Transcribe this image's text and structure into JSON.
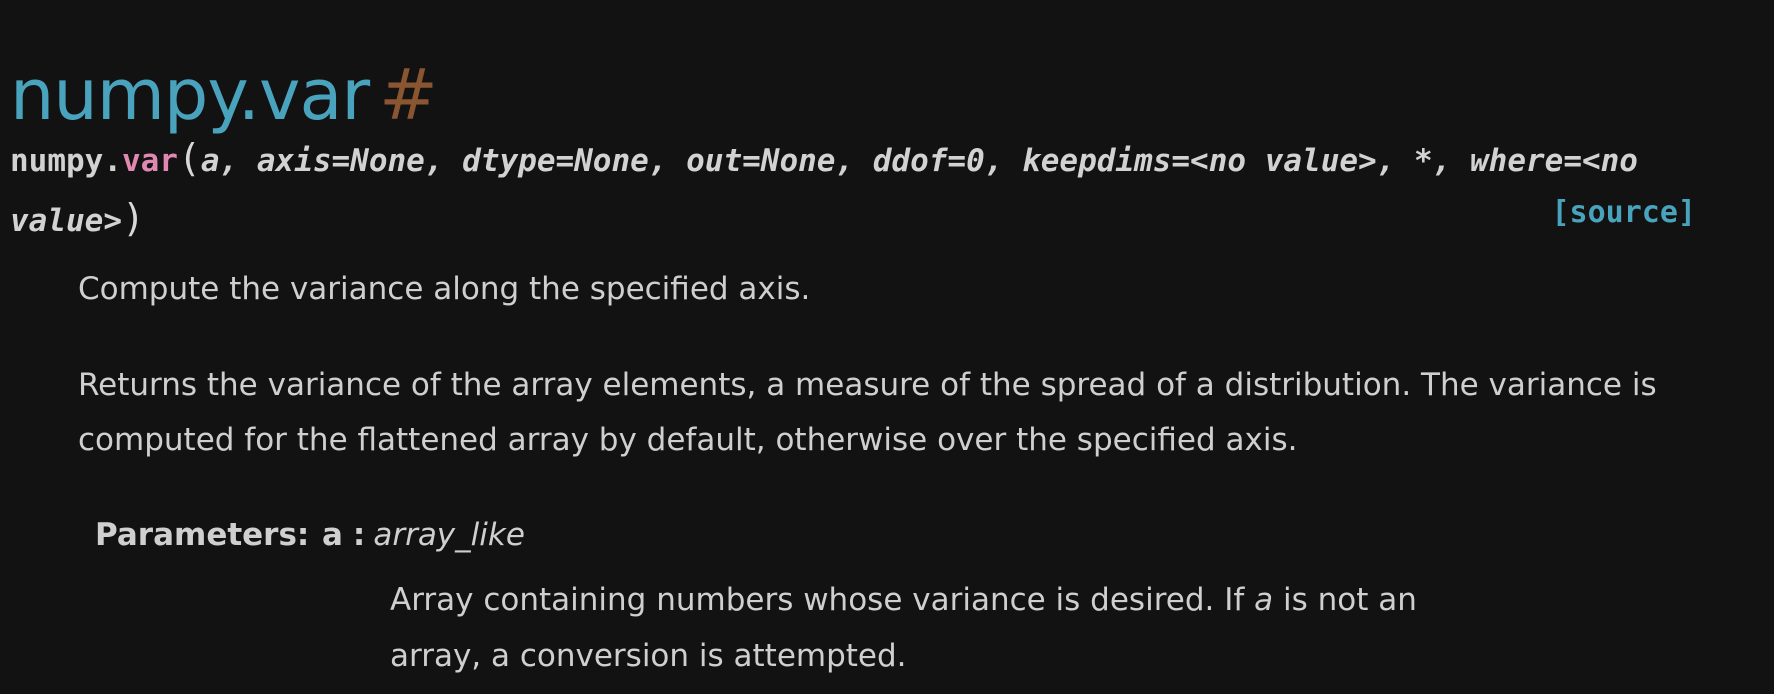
{
  "header": {
    "title": "numpy.var",
    "anchor": "#"
  },
  "signature": {
    "module": "numpy.",
    "function": "var",
    "open_paren": "(",
    "line1_params": "a, axis=None, dtype=None, out=None, ddof=0, keepdims=<no value>, *, where=<no",
    "line2_params": "value>",
    "close_paren": ")",
    "source_link": "[source]"
  },
  "description": {
    "summary": "Compute the variance along the specified axis.",
    "extended": "Returns the variance of the array elements, a measure of the spread of a distribution. The variance is computed for the flattened array by default, otherwise over the specified axis."
  },
  "parameters": {
    "label": "Parameters:",
    "items": [
      {
        "name": "a",
        "separator": ":",
        "type": "array_like",
        "desc_before": "Array containing numbers whose variance is desired. If ",
        "desc_em": "a",
        "desc_after": " is not an array, a conversion is attempted."
      }
    ]
  },
  "colors": {
    "background": "#121212",
    "title": "#4aa3bd",
    "anchor": "#8a5631",
    "function_name": "#e088b1",
    "source_link": "#4aa3bd",
    "text": "#cfcfcf"
  }
}
